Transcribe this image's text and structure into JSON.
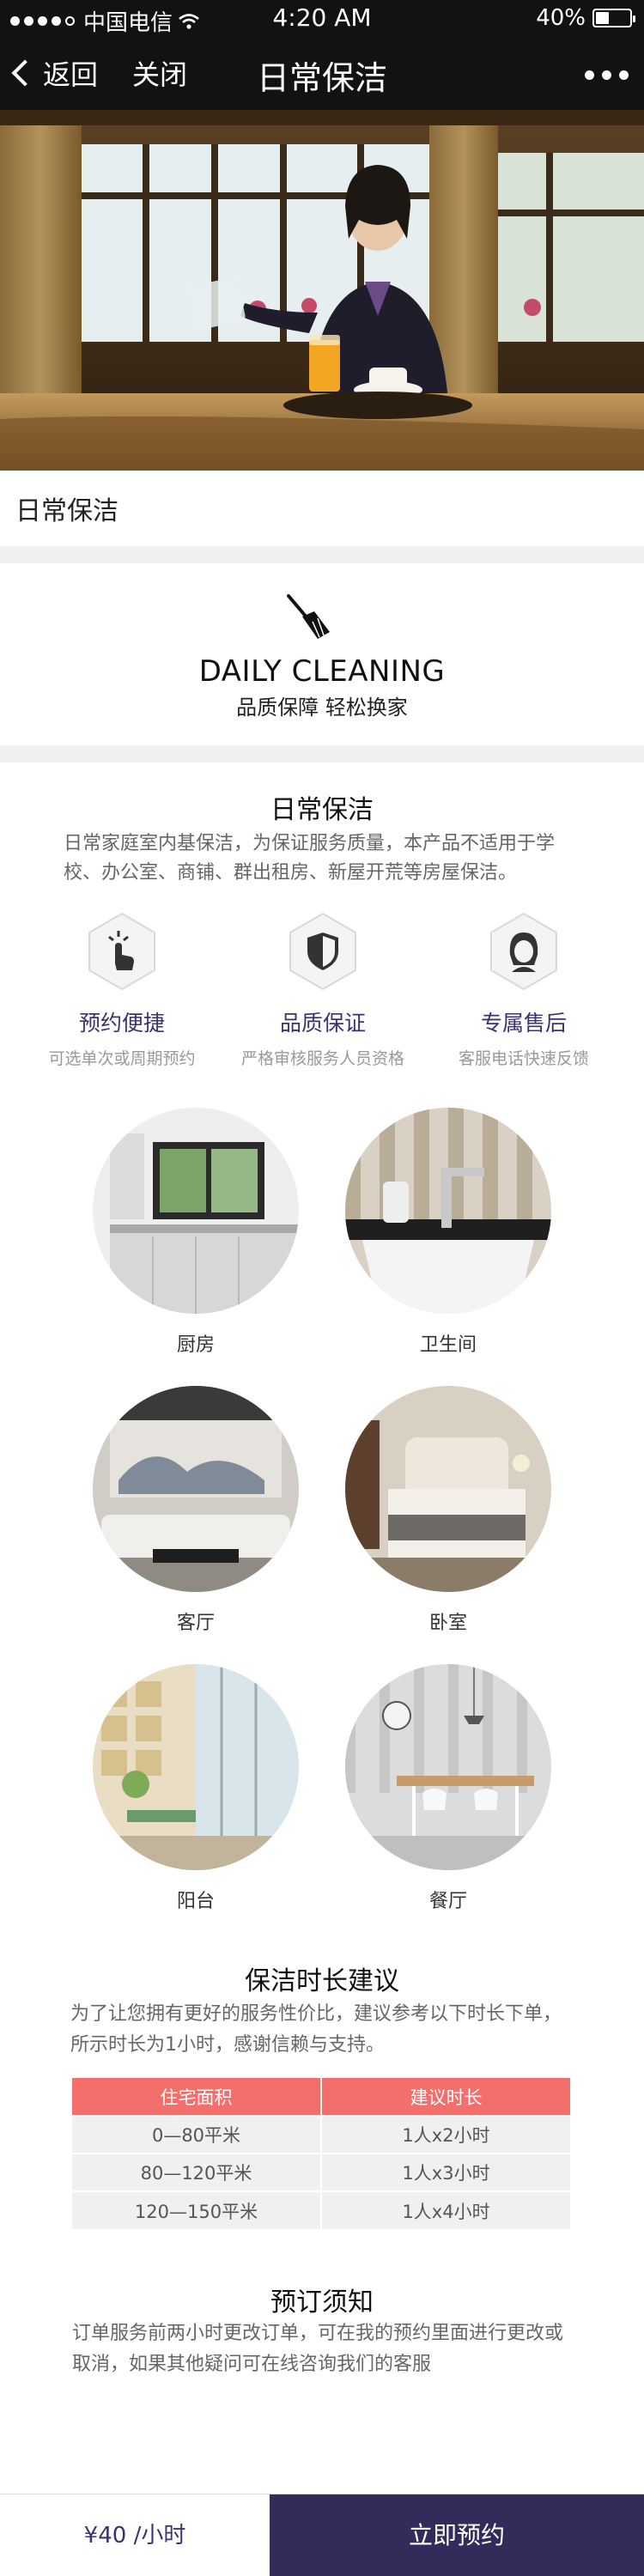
{
  "status_bar": {
    "carrier": "中国电信",
    "time": "4:20 AM",
    "battery": "40%",
    "battery_level": 0.4
  },
  "nav": {
    "back_label": "返回",
    "close_label": "关闭",
    "title": "日常保洁"
  },
  "section_title": "日常保洁",
  "daily": {
    "english": "DAILY CLEANING",
    "slogan": "品质保障  轻松换家"
  },
  "intro": {
    "title": "日常保洁",
    "text": "日常家庭室内基保洁，为保证服务质量，本产品不适用于学校、办公室、商铺、群出租房、新屋开荒等房屋保洁。"
  },
  "features": [
    {
      "icon": "hand-tap-icon",
      "title": "预约便捷",
      "subtitle": "可选单次或周期预约"
    },
    {
      "icon": "shield-check-icon",
      "title": "品质保证",
      "subtitle": "严格审核服务人员资格"
    },
    {
      "icon": "service-agent-icon",
      "title": "专属售后",
      "subtitle": "客服电话快速反馈"
    }
  ],
  "rooms": [
    {
      "label": "厨房"
    },
    {
      "label": "卫生间"
    },
    {
      "label": "客厅"
    },
    {
      "label": "卧室"
    },
    {
      "label": "阳台"
    },
    {
      "label": "餐厅"
    }
  ],
  "duration": {
    "title": "保洁时长建议",
    "text": "为了让您拥有更好的服务性价比，建议参考以下时长下单，所示时长为1小时，感谢信赖与支持。",
    "headers": [
      "住宅面积",
      "建议时长"
    ],
    "rows": [
      [
        "0—80平米",
        "1人x2小时"
      ],
      [
        "80—120平米",
        "1人x3小时"
      ],
      [
        "120—150平米",
        "1人x4小时"
      ]
    ]
  },
  "notice": {
    "title": "预订须知",
    "text": "订单服务前两小时更改订单，可在我的预约里面进行更改或取消，如果其他疑问可在线咨询我们的客服"
  },
  "bottom": {
    "price": "¥40 /小时",
    "book_label": "立即预约"
  },
  "colors": {
    "accent": "#332b59",
    "table_header": "#f26f6b",
    "feature_title": "#3b3271"
  }
}
